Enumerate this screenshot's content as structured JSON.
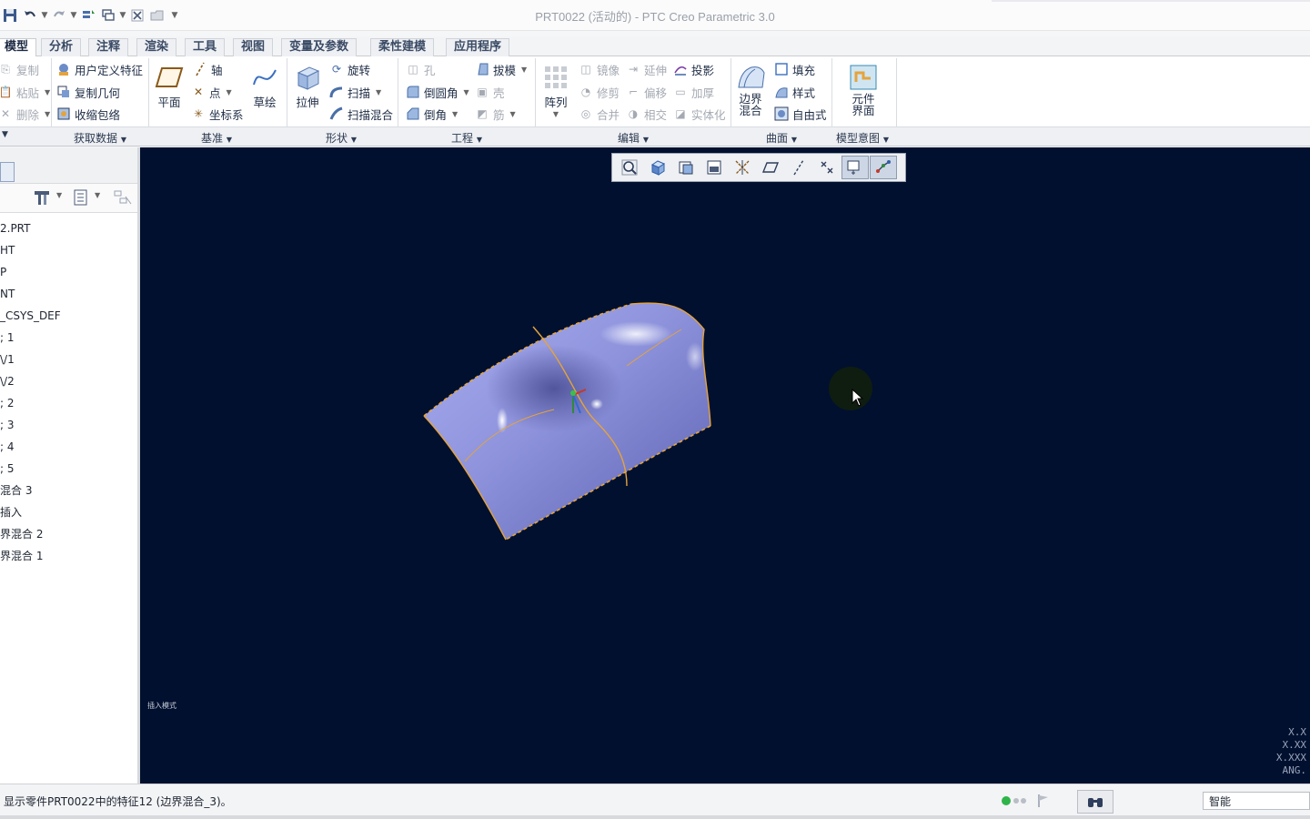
{
  "window": {
    "title": "PRT0022 (活动的) - PTC Creo Parametric 3.0"
  },
  "quick_access": [
    "save-icon",
    "undo-icon",
    "redo-icon",
    "regenerate-icon",
    "windows-icon",
    "close-window-icon",
    "open-icon",
    "customize-icon"
  ],
  "ribbon_tabs": [
    {
      "label": "模型",
      "active": true
    },
    {
      "label": "分析"
    },
    {
      "label": "注释"
    },
    {
      "label": "渲染"
    },
    {
      "label": "工具"
    },
    {
      "label": "视图"
    },
    {
      "label": "变量及参数"
    },
    {
      "label": "柔性建模"
    },
    {
      "label": "应用程序"
    }
  ],
  "ribbon": {
    "clipboard": {
      "copy": "复制",
      "paste": "粘贴",
      "delete": "删除"
    },
    "get_data": {
      "label": "获取数据",
      "udf": "用户定义特征",
      "copy_geom": "复制几何",
      "shrinkwrap": "收缩包络"
    },
    "datum": {
      "label": "基准",
      "plane": "平面",
      "axis": "轴",
      "point": "点",
      "csys": "坐标系",
      "sketch": "草绘"
    },
    "shapes": {
      "label": "形状",
      "extrude": "拉伸",
      "revolve": "旋转",
      "sweep": "扫描",
      "swept_blend": "扫描混合"
    },
    "engineering": {
      "label": "工程",
      "hole": "孔",
      "round": "倒圆角",
      "chamfer": "倒角",
      "draft": "拔模",
      "shell": "壳",
      "rib": "筋"
    },
    "editing": {
      "label": "编辑",
      "pattern": "阵列",
      "mirror": "镜像",
      "extend": "延伸",
      "project": "投影",
      "trim": "修剪",
      "offset": "偏移",
      "thicken": "加厚",
      "merge": "合并",
      "intersect": "相交",
      "solidify": "实体化"
    },
    "surfaces": {
      "label": "曲面",
      "boundary_blend": "边界混合",
      "boundary_line1": "边界",
      "boundary_line2": "混合",
      "fill": "填充",
      "style": "样式",
      "freestyle": "自由式"
    },
    "model_intent": {
      "label": "模型意图",
      "component_interface_1": "元件",
      "component_interface_2": "界面"
    }
  },
  "model_tree": {
    "items": [
      "2.PRT",
      "HT",
      "P",
      "NT",
      "_CSYS_DEF",
      "; 1",
      "\\/1",
      "\\/2",
      "; 2",
      "; 3",
      "; 4",
      "; 5",
      "混合 3",
      "插入",
      "界混合 2",
      "界混合 1"
    ]
  },
  "viewport": {
    "background": "#01102f",
    "insert_mode": "插入模式",
    "coords": [
      "X.X",
      "X.XX",
      "X.XXX",
      "ANG."
    ]
  },
  "view_toolbar": [
    "refit-icon",
    "zoom-in-icon",
    "repaint-icon",
    "view-manager-icon",
    "datum-display-icon",
    "plane-display-icon",
    "axis-display-icon",
    "point-display-icon",
    "csys-display-icon",
    "annotation-display-icon"
  ],
  "status": {
    "message": "显示零件PRT0022中的特征12 (边界混合_3)。",
    "filter_value": "智能"
  }
}
